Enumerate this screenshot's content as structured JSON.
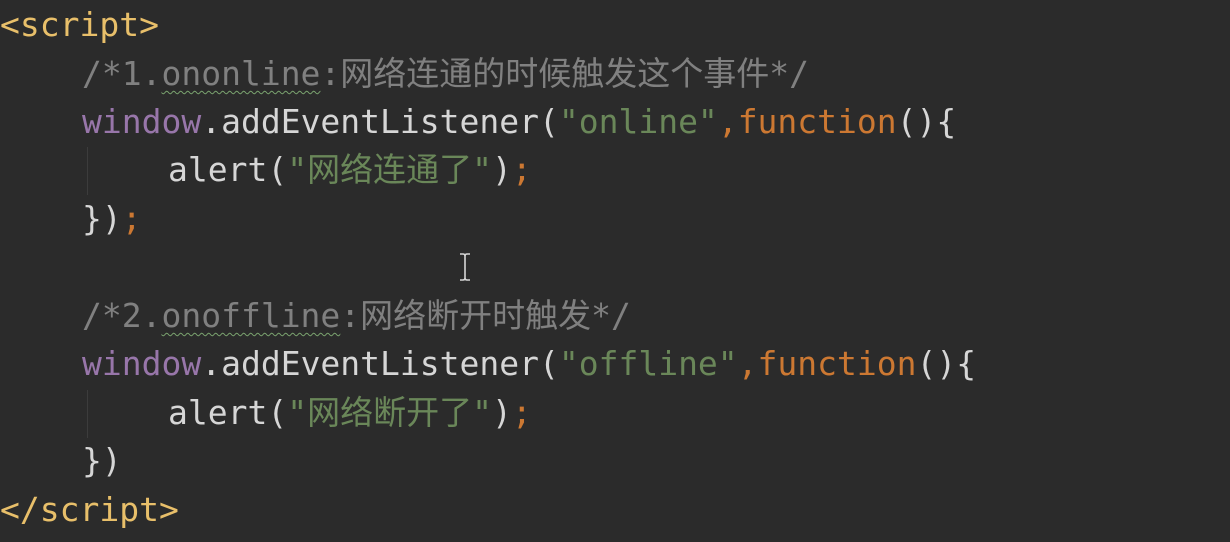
{
  "code": {
    "line1": {
      "open": "<",
      "tag": "script",
      "close": ">"
    },
    "line2": {
      "comment_pre": "/*1.",
      "comment_word": "ononline",
      "comment_post": ":网络连通的时候触发这个事件*/"
    },
    "line3": {
      "obj": "window",
      "dot": ".",
      "method": "addEventListener",
      "paren": "(",
      "event": "\"online\"",
      "comma": ",",
      "kw": "function",
      "rest": "(){"
    },
    "line4": {
      "fn": "alert",
      "paren_open": "(",
      "msg": "\"网络连通了\"",
      "paren_close": ")",
      "semi": ";"
    },
    "line5": {
      "close": "})",
      "semi": ";"
    },
    "line7": {
      "comment_pre": "/*2.",
      "comment_word": "onoffline",
      "comment_post": ":网络断开时触发*/"
    },
    "line8": {
      "obj": "window",
      "dot": ".",
      "method": "addEventListener",
      "paren": "(",
      "event": "\"offline\"",
      "comma": ",",
      "kw": "function",
      "rest": "(){"
    },
    "line9": {
      "fn": "alert",
      "paren_open": "(",
      "msg": "\"网络断开了\"",
      "paren_close": ")",
      "semi": ";"
    },
    "line10": {
      "close": "})"
    },
    "line11": {
      "open": "</",
      "tag": "script",
      "close": ">"
    }
  },
  "colors": {
    "background": "#2b2b2b",
    "tag": "#e8bf6a",
    "comment": "#808080",
    "object": "#9876aa",
    "string": "#6a8759",
    "keyword": "#cc7832",
    "default": "#d6d6d6"
  },
  "icons": {
    "text_cursor": "i-beam-cursor-icon"
  }
}
